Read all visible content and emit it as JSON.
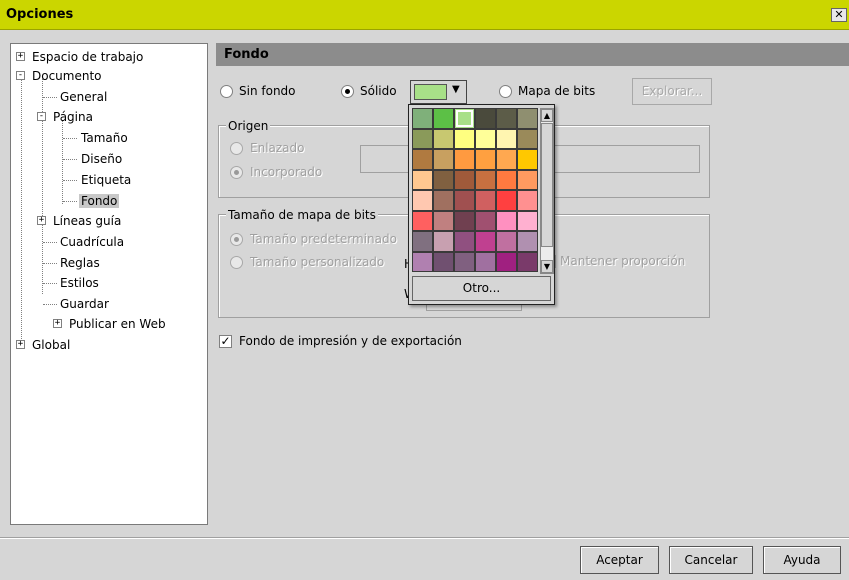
{
  "window": {
    "title": "Opciones"
  },
  "tree": {
    "items": [
      {
        "label": "Espacio de trabajo",
        "expander": "+"
      },
      {
        "label": "Documento",
        "expander": "-"
      },
      {
        "label": "General"
      },
      {
        "label": "Página",
        "expander": "-"
      },
      {
        "label": "Tamaño"
      },
      {
        "label": "Diseño"
      },
      {
        "label": "Etiqueta"
      },
      {
        "label": "Fondo",
        "selected": true
      },
      {
        "label": "Líneas guía",
        "expander": "+"
      },
      {
        "label": "Cuadrícula"
      },
      {
        "label": "Reglas"
      },
      {
        "label": "Estilos"
      },
      {
        "label": "Guardar"
      },
      {
        "label": "Publicar en Web",
        "expander": "+"
      },
      {
        "label": "Global",
        "expander": "+"
      }
    ]
  },
  "panel": {
    "header": "Fondo",
    "radio_sin_fondo": "Sin fondo",
    "radio_solido": "Sólido",
    "radio_mapa_bits": "Mapa de bits",
    "explorar": "Explorar...",
    "origen": {
      "title": "Origen",
      "enlazado": "Enlazado",
      "incorporado": "Incorporado"
    },
    "tamano": {
      "title": "Tamaño de mapa de bits",
      "predeterminado": "Tamaño predeterminado",
      "personalizado": "Tamaño personalizado",
      "h_label": "H",
      "w_label": "W",
      "mantener": "Mantener proporción"
    },
    "checkbox_fondo": "Fondo de impresión y de exportación"
  },
  "color_picker": {
    "current_color": "#a8e088",
    "otro": "Otro...",
    "palette": [
      "#7fb07a",
      "#5cc046",
      "#a8e088",
      "#4a4a3c",
      "#5c5c48",
      "#8f8f70",
      "#8a9a5a",
      "#c8c870",
      "#ffff80",
      "#ffff99",
      "#fff5b0",
      "#9a8a5a",
      "#b07a40",
      "#c8a060",
      "#ff9a40",
      "#ffa040",
      "#ffa850",
      "#ffc800",
      "#ffc890",
      "#806040",
      "#a05a3a",
      "#c87040",
      "#ff7a40",
      "#ff9a60",
      "#ffc8b0",
      "#a07060",
      "#a05050",
      "#d06060",
      "#ff4040",
      "#ff9090",
      "#ff6060",
      "#c08080",
      "#704050",
      "#a05070",
      "#ff90c0",
      "#ffb0d0",
      "#807080",
      "#c8a0b0",
      "#905080",
      "#c04090",
      "#c070a0",
      "#b090b0",
      "#b080b0",
      "#705070",
      "#806080",
      "#a070a0",
      "#a02080",
      "#7a3a6a"
    ]
  },
  "buttons": {
    "aceptar": "Aceptar",
    "cancelar": "Cancelar",
    "ayuda": "Ayuda"
  }
}
